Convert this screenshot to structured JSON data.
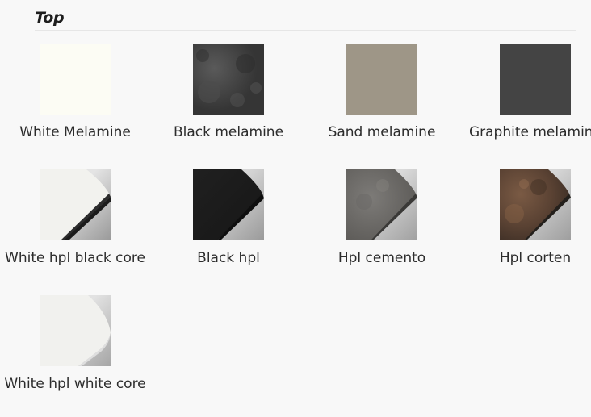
{
  "section": {
    "title": "Top"
  },
  "finishes": [
    {
      "label": "White Melamine",
      "swatch": "white-melamine-swatch",
      "color": "#fbfbf0"
    },
    {
      "label": "Black melamine",
      "swatch": "black-melamine-swatch",
      "color": "#3e3e3e"
    },
    {
      "label": "Sand melamine",
      "swatch": "sand-melamine-swatch",
      "color": "#9c9484"
    },
    {
      "label": "Graphite melamine",
      "swatch": "graphite-melamine-swatch",
      "color": "#434343"
    },
    {
      "label": "White hpl black core",
      "swatch": "white-hpl-black-core-swatch",
      "color": "#f2f2ee"
    },
    {
      "label": "Black hpl",
      "swatch": "black-hpl-swatch",
      "color": "#1f1f1f"
    },
    {
      "label": "Hpl cemento",
      "swatch": "hpl-cemento-swatch",
      "color": "#6f6d6a"
    },
    {
      "label": "Hpl corten",
      "swatch": "hpl-corten-swatch",
      "color": "#5e4636"
    },
    {
      "label": "White hpl white core",
      "swatch": "white-hpl-white-core-swatch",
      "color": "#f1f1ee"
    }
  ]
}
